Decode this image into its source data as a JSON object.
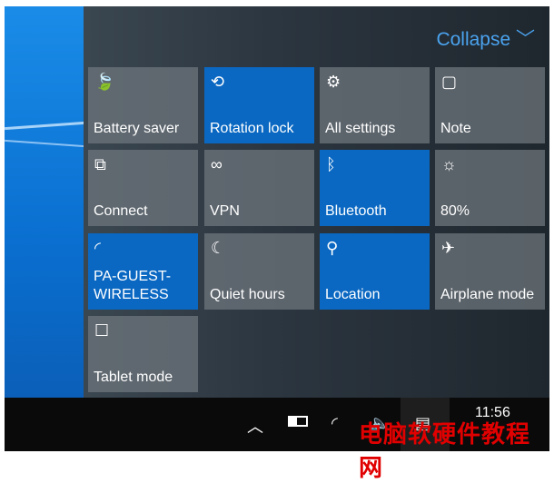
{
  "header": {
    "collapse_label": "Collapse",
    "collapse_icon": "chevron-down-icon"
  },
  "tiles": [
    {
      "label": "Battery saver",
      "icon": "leaf-icon",
      "glyph": "🍃",
      "active": false
    },
    {
      "label": "Rotation lock",
      "icon": "rotation-lock-icon",
      "glyph": "⟲",
      "active": true
    },
    {
      "label": "All settings",
      "icon": "gear-icon",
      "glyph": "⚙",
      "active": false
    },
    {
      "label": "Note",
      "icon": "note-icon",
      "glyph": "▢",
      "active": false
    },
    {
      "label": "Connect",
      "icon": "connect-icon",
      "glyph": "⧉",
      "active": false
    },
    {
      "label": "VPN",
      "icon": "vpn-icon",
      "glyph": "∞",
      "active": false
    },
    {
      "label": "Bluetooth",
      "icon": "bluetooth-icon",
      "glyph": "ᛒ",
      "active": true
    },
    {
      "label": "80%",
      "icon": "brightness-icon",
      "glyph": "☼",
      "active": false
    },
    {
      "label": "PA-GUEST-\nWIRELESS",
      "icon": "wifi-icon",
      "glyph": "◜",
      "active": true
    },
    {
      "label": "Quiet hours",
      "icon": "moon-icon",
      "glyph": "☾",
      "active": false
    },
    {
      "label": "Location",
      "icon": "location-icon",
      "glyph": "⚲",
      "active": true
    },
    {
      "label": "Airplane mode",
      "icon": "airplane-icon",
      "glyph": "✈",
      "active": false
    },
    {
      "label": "Tablet mode",
      "icon": "tablet-mode-icon",
      "glyph": "☐",
      "active": false
    }
  ],
  "colors": {
    "active_tile": "#0a68c2",
    "accent_text": "#4aa3ef"
  },
  "taskbar": {
    "time": "11:56",
    "icons": [
      "chevron-up-icon",
      "battery-icon",
      "wifi-icon",
      "volume-mute-icon",
      "action-center-icon"
    ]
  },
  "watermark": "电脑软硬件教程网"
}
